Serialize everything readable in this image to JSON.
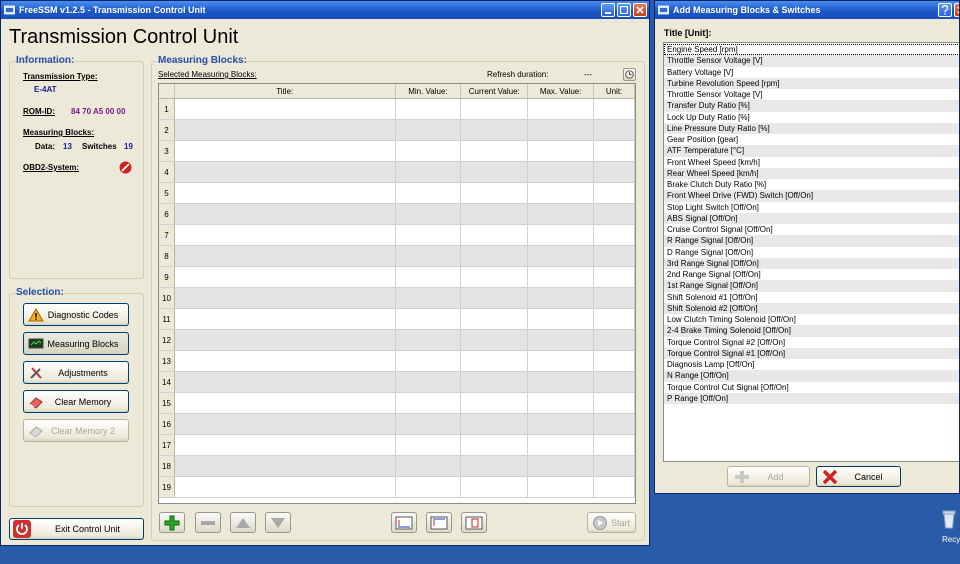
{
  "main_window": {
    "title": "FreeSSM v1.2.5 - Transmission Control Unit",
    "heading": "Transmission Control Unit",
    "information": {
      "header": "Information:",
      "transmission_type_label": "Transmission Type:",
      "transmission_type_value": "E-4AT",
      "rom_id_label": "ROM-ID:",
      "rom_id_value": "84 70 A5 00 00",
      "measuring_blocks_label": "Measuring Blocks:",
      "data_label": "Data:",
      "data_value": "13",
      "switches_label": "Switches",
      "switches_value": "19",
      "obd2_label": "OBD2-System:"
    },
    "selection": {
      "header": "Selection:",
      "diagnostic_codes": "Diagnostic Codes",
      "measuring_blocks": "Measuring Blocks",
      "adjustments": "Adjustments",
      "clear_memory": "Clear Memory",
      "clear_memory_2": "Clear Memory 2"
    },
    "exit_button": "Exit Control Unit",
    "measuring": {
      "header": "Measuring Blocks:",
      "selected_label": "Selected Measuring Blocks:",
      "refresh_label": "Refresh duration:",
      "refresh_value": "---",
      "columns": [
        "Title:",
        "Min. Value:",
        "Current Value:",
        "Max. Value:",
        "Unit:"
      ],
      "row_numbers": [
        "1",
        "2",
        "3",
        "4",
        "5",
        "6",
        "7",
        "8",
        "9",
        "10",
        "11",
        "12",
        "13",
        "14",
        "15",
        "16",
        "17",
        "18",
        "19"
      ],
      "start_button": "Start"
    }
  },
  "add_window": {
    "title": "Add Measuring Blocks & Switches",
    "list_header": "Title   [Unit]:",
    "items": [
      "Engine Speed   [rpm]",
      "Throttle Sensor Voltage   [V]",
      "Battery Voltage   [V]",
      "Turbine Revolution Speed   [rpm]",
      "Throttle Sensor Voltage   [V]",
      "Transfer Duty Ratio   [%]",
      "Lock Up Duty Ratio   [%]",
      "Line Pressure Duty Ratio   [%]",
      "Gear Position   [gear]",
      "ATF Temperature   [°C]",
      "Front Wheel Speed   [km/h]",
      "Rear Wheel Speed   [km/h]",
      "Brake Clutch Duty Ratio   [%]",
      "Front Wheel Drive (FWD) Switch   [Off/On]",
      "Stop Light Switch   [Off/On]",
      "ABS Signal   [Off/On]",
      "Cruise Control Signal   [Off/On]",
      "R Range Signal   [Off/On]",
      "D Range Signal   [Off/On]",
      "3rd Range Signal   [Off/On]",
      "2nd Range Signal   [Off/On]",
      "1st Range Signal   [Off/On]",
      "Shift Solenoid #1   [Off/On]",
      "Shift Solenoid #2   [Off/On]",
      "Low Clutch Timing Solenoid   [Off/On]",
      "2-4 Brake Timing Solenoid   [Off/On]",
      "Torque Control Signal #2   [Off/On]",
      "Torque Control Signal #1   [Off/On]",
      "Diagnosis Lamp   [Off/On]",
      "N Range   [Off/On]",
      "Torque Control Cut Signal   [Off/On]",
      "P Range   [Off/On]"
    ],
    "add_button": "Add",
    "cancel_button": "Cancel"
  },
  "desktop": {
    "recycle_label": "Recy"
  }
}
